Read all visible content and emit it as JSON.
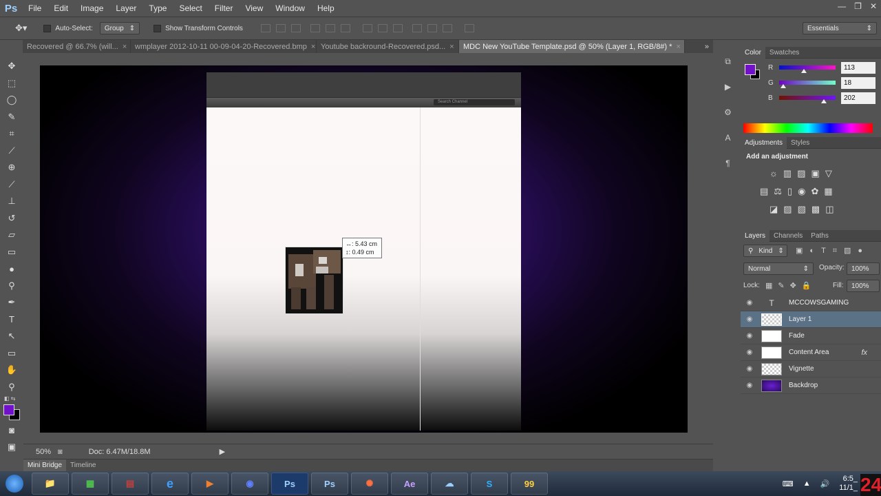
{
  "app": {
    "logo": "Ps",
    "window_controls": [
      "—",
      "❐",
      "✕"
    ]
  },
  "menu": [
    "File",
    "Edit",
    "Image",
    "Layer",
    "Type",
    "Select",
    "Filter",
    "View",
    "Window",
    "Help"
  ],
  "options": {
    "auto_select": "Auto-Select:",
    "group": "Group",
    "transform": "Show Transform Controls",
    "workspace": "Essentials"
  },
  "tabs": [
    {
      "label": "Recovered @ 66.7% (will...",
      "active": false
    },
    {
      "label": "wmplayer 2012-10-11 00-09-04-20-Recovered.bmp",
      "active": false
    },
    {
      "label": "Youtube backround-Recovered.psd...",
      "active": false
    },
    {
      "label": "MDC New YouTube Template.psd @ 50% (Layer 1, RGB/8#) *",
      "active": true
    }
  ],
  "document": {
    "search_placeholder": "Search Channel",
    "measure": {
      "w": "↔: 5.43 cm",
      "h": "↕: 0.49 cm"
    }
  },
  "status": {
    "zoom": "50%",
    "doc": "Doc: 6.47M/18.8M"
  },
  "minibridge": {
    "tabs": [
      "Mini Bridge",
      "Timeline"
    ]
  },
  "color": {
    "tabs": [
      "Color",
      "Swatches"
    ],
    "fg": "#7112ca",
    "channels": [
      {
        "label": "R",
        "value": "113"
      },
      {
        "label": "G",
        "value": "18"
      },
      {
        "label": "B",
        "value": "202"
      }
    ]
  },
  "adjustments": {
    "tabs": [
      "Adjustments",
      "Styles"
    ],
    "title": "Add an adjustment"
  },
  "layers": {
    "tabs": [
      "Layers",
      "Channels",
      "Paths"
    ],
    "filter": "Kind",
    "blend": "Normal",
    "opacity_label": "Opacity:",
    "opacity": "100%",
    "lock_label": "Lock:",
    "fill_label": "Fill:",
    "fill": "100%",
    "items": [
      {
        "name": "MCCOWSGAMING",
        "type": "text",
        "selected": false
      },
      {
        "name": "Layer 1",
        "type": "pixel",
        "selected": true
      },
      {
        "name": "Fade",
        "type": "white",
        "selected": false
      },
      {
        "name": "Content Area",
        "type": "white",
        "selected": false,
        "fx": "fx"
      },
      {
        "name": "Vignette",
        "type": "checker",
        "selected": false
      },
      {
        "name": "Backdrop",
        "type": "purple",
        "selected": false
      }
    ]
  },
  "taskbar": {
    "apps": [
      "📁",
      "▦",
      "▤",
      "e",
      "▶",
      "◉",
      "Ps",
      "Ps",
      "✺",
      "Ae",
      "☁",
      "S",
      "99"
    ],
    "time": "6:5_",
    "date": "11/1_",
    "corner": "24"
  }
}
